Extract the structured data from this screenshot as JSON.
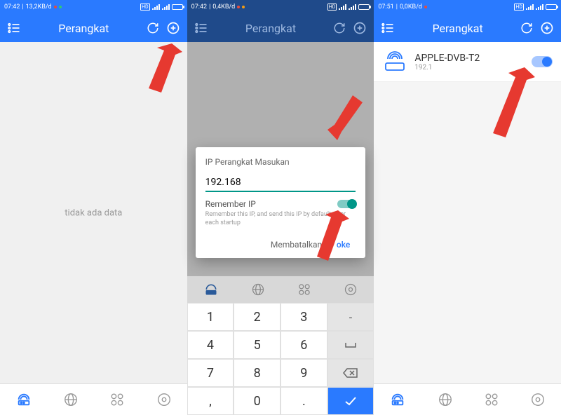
{
  "colors": {
    "primary": "#2a7aff",
    "teal": "#009688",
    "arrow": "#e63930"
  },
  "screens": {
    "s1": {
      "status": {
        "time": "07:42",
        "net": "13,2KB/d"
      },
      "title": "Perangkat",
      "empty": "tidak ada data"
    },
    "s2": {
      "status": {
        "time": "07:42",
        "net": "0,4KB/d"
      },
      "title": "Perangkat",
      "dialog": {
        "title": "IP Perangkat Masukan",
        "value": "192.168",
        "remember_label": "Remember IP",
        "remember_hint": "Remember this IP, and send this IP by default after each startup",
        "cancel": "Membatalkan",
        "ok": "oke"
      },
      "keypad": {
        "rows": [
          [
            "1",
            "2",
            "3",
            "-"
          ],
          [
            "4",
            "5",
            "6",
            "␣"
          ],
          [
            "7",
            "8",
            "9",
            "⌫"
          ],
          [
            ",",
            "0",
            ".",
            "✓"
          ]
        ]
      }
    },
    "s3": {
      "status": {
        "time": "07:51",
        "net": "0,0KB/d"
      },
      "title": "Perangkat",
      "device": {
        "name": "APPLE-DVB-T2",
        "ip": "192.1"
      }
    }
  }
}
